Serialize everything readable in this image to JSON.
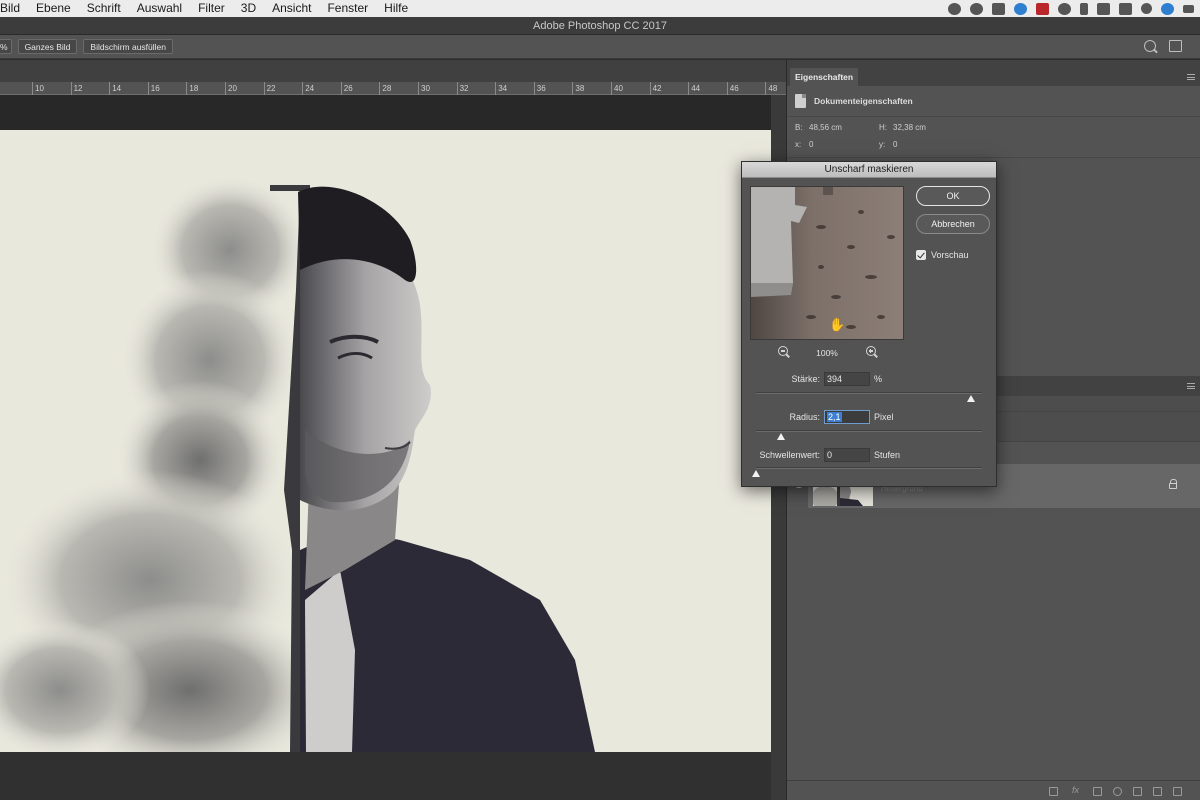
{
  "menubar": {
    "items": [
      "Bild",
      "Ebene",
      "Schrift",
      "Auswahl",
      "Filter",
      "3D",
      "Ansicht",
      "Fenster",
      "Hilfe"
    ],
    "tray_icons": [
      "record-icon",
      "creative-cloud-icon",
      "screen-icon",
      "app-icon",
      "red-app-icon",
      "time-machine-icon",
      "bluetooth-icon",
      "wifi-icon",
      "airplay-icon",
      "spotlight-icon",
      "siri-icon",
      "menu-icon"
    ]
  },
  "window": {
    "title": "Adobe Photoshop CC 2017"
  },
  "options": {
    "zoom_fragment": "%",
    "fit_button": "Ganzes Bild",
    "fill_button": "Bildschirm ausfüllen"
  },
  "ruler": {
    "ticks": [
      "10",
      "12",
      "14",
      "16",
      "18",
      "20",
      "22",
      "24",
      "26",
      "28",
      "30",
      "32",
      "34",
      "36",
      "38",
      "40",
      "42",
      "44",
      "46",
      "48"
    ]
  },
  "properties": {
    "tab": "Eigenschaften",
    "section": "Dokumenteigenschaften",
    "w_label": "B:",
    "w_value": "48,56 cm",
    "h_label": "H:",
    "h_value": "32,38 cm",
    "x_label": "x:",
    "x_value": "0",
    "y_label": "y:",
    "y_value": "0"
  },
  "layers": {
    "background_name": "Hintergrund"
  },
  "dialog": {
    "title": "Unscharf maskieren",
    "ok": "OK",
    "cancel": "Abbrechen",
    "preview_label": "Vorschau",
    "preview_checked": true,
    "zoom": "100%",
    "amount": {
      "label": "Stärke:",
      "value": "394",
      "unit": "%",
      "slider_fraction": 0.95
    },
    "radius": {
      "label": "Radius:",
      "value": "2,1",
      "unit": "Pixel",
      "slider_fraction": 0.11
    },
    "threshold": {
      "label": "Schwellenwert:",
      "value": "0",
      "unit": "Stufen",
      "slider_fraction": 0.0
    }
  },
  "colors": {
    "canvas_bg": "#e9e8dd",
    "panel_bg": "#535353",
    "selection": "#3e7fd4"
  }
}
